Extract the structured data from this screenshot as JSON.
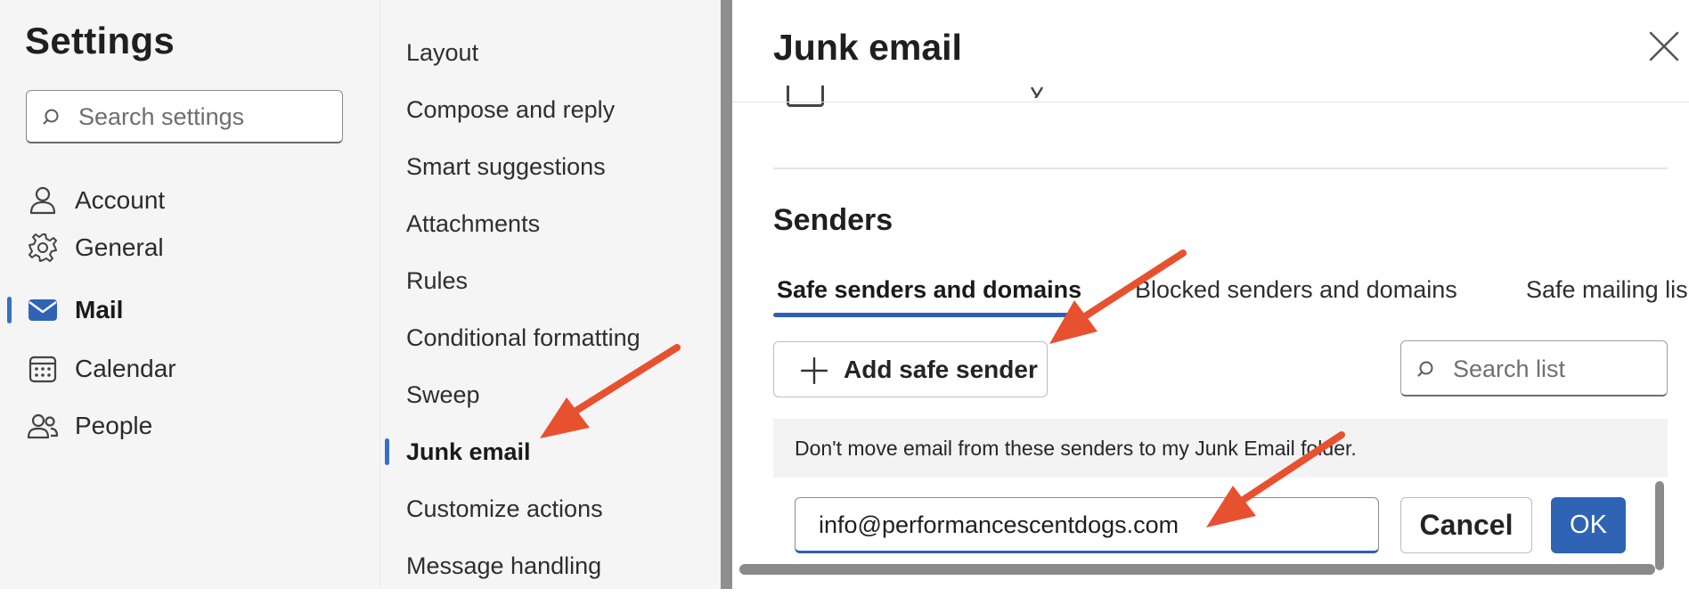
{
  "settings": {
    "title": "Settings",
    "search_placeholder": "Search settings"
  },
  "nav": {
    "items": [
      {
        "label": "Account",
        "icon": "person-icon",
        "selected": false
      },
      {
        "label": "General",
        "icon": "gear-icon",
        "selected": false
      },
      {
        "label": "Mail",
        "icon": "mail-icon",
        "selected": true
      },
      {
        "label": "Calendar",
        "icon": "calendar-icon",
        "selected": false
      },
      {
        "label": "People",
        "icon": "people-icon",
        "selected": false
      }
    ]
  },
  "mail_menu": {
    "items": [
      {
        "label": "Layout",
        "selected": false
      },
      {
        "label": "Compose and reply",
        "selected": false
      },
      {
        "label": "Smart suggestions",
        "selected": false
      },
      {
        "label": "Attachments",
        "selected": false
      },
      {
        "label": "Rules",
        "selected": false
      },
      {
        "label": "Conditional formatting",
        "selected": false
      },
      {
        "label": "Sweep",
        "selected": false
      },
      {
        "label": "Junk email",
        "selected": true
      },
      {
        "label": "Customize actions",
        "selected": false
      },
      {
        "label": "Message handling",
        "selected": false
      }
    ]
  },
  "panel": {
    "title": "Junk email",
    "close_icon": "close-icon",
    "senders_heading": "Senders",
    "tabs": [
      {
        "label": "Safe senders and domains",
        "active": true
      },
      {
        "label": "Blocked senders and domains",
        "active": false
      },
      {
        "label": "Safe mailing lis",
        "active": false
      }
    ],
    "add_button_label": "Add safe sender",
    "search_list_placeholder": "Search list",
    "info_text": "Don't move email from these senders to my Junk Email folder.",
    "email_value": "info@performancescentdogs.com",
    "cancel_label": "Cancel",
    "ok_label": "OK"
  },
  "colors": {
    "accent": "#2f64b4",
    "annotation_arrow": "#e8512f",
    "nav_background": "#f5f5f5",
    "scrollbar": "#8f8f8f"
  }
}
